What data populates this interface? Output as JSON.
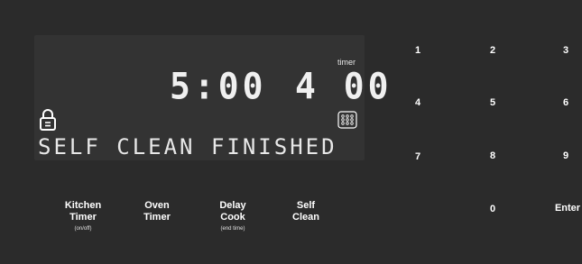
{
  "display": {
    "clock": "5:00",
    "timer_label": "timer",
    "timer_value": "4 00",
    "message": "SELF CLEAN FINISHED"
  },
  "keypad": {
    "k1": "1",
    "k2": "2",
    "k3": "3",
    "k4": "4",
    "k5": "5",
    "k6": "6",
    "k7": "7",
    "k8": "8",
    "k9": "9",
    "k0": "0",
    "enter": "Enter"
  },
  "functions": {
    "kitchen_timer": {
      "line1": "Kitchen",
      "line2": "Timer",
      "sub": "(on/off)"
    },
    "oven_timer": {
      "line1": "Oven",
      "line2": "Timer"
    },
    "delay_cook": {
      "line1": "Delay",
      "line2": "Cook",
      "sub": "(end time)"
    },
    "self_clean": {
      "line1": "Self",
      "line2": "Clean"
    }
  },
  "icons": {
    "lock": "lock-icon",
    "convection": "dots-grid-icon"
  },
  "colors": {
    "panel": "#2b2b2b",
    "lcd": "#333333",
    "segment": "#f0f0f0"
  }
}
